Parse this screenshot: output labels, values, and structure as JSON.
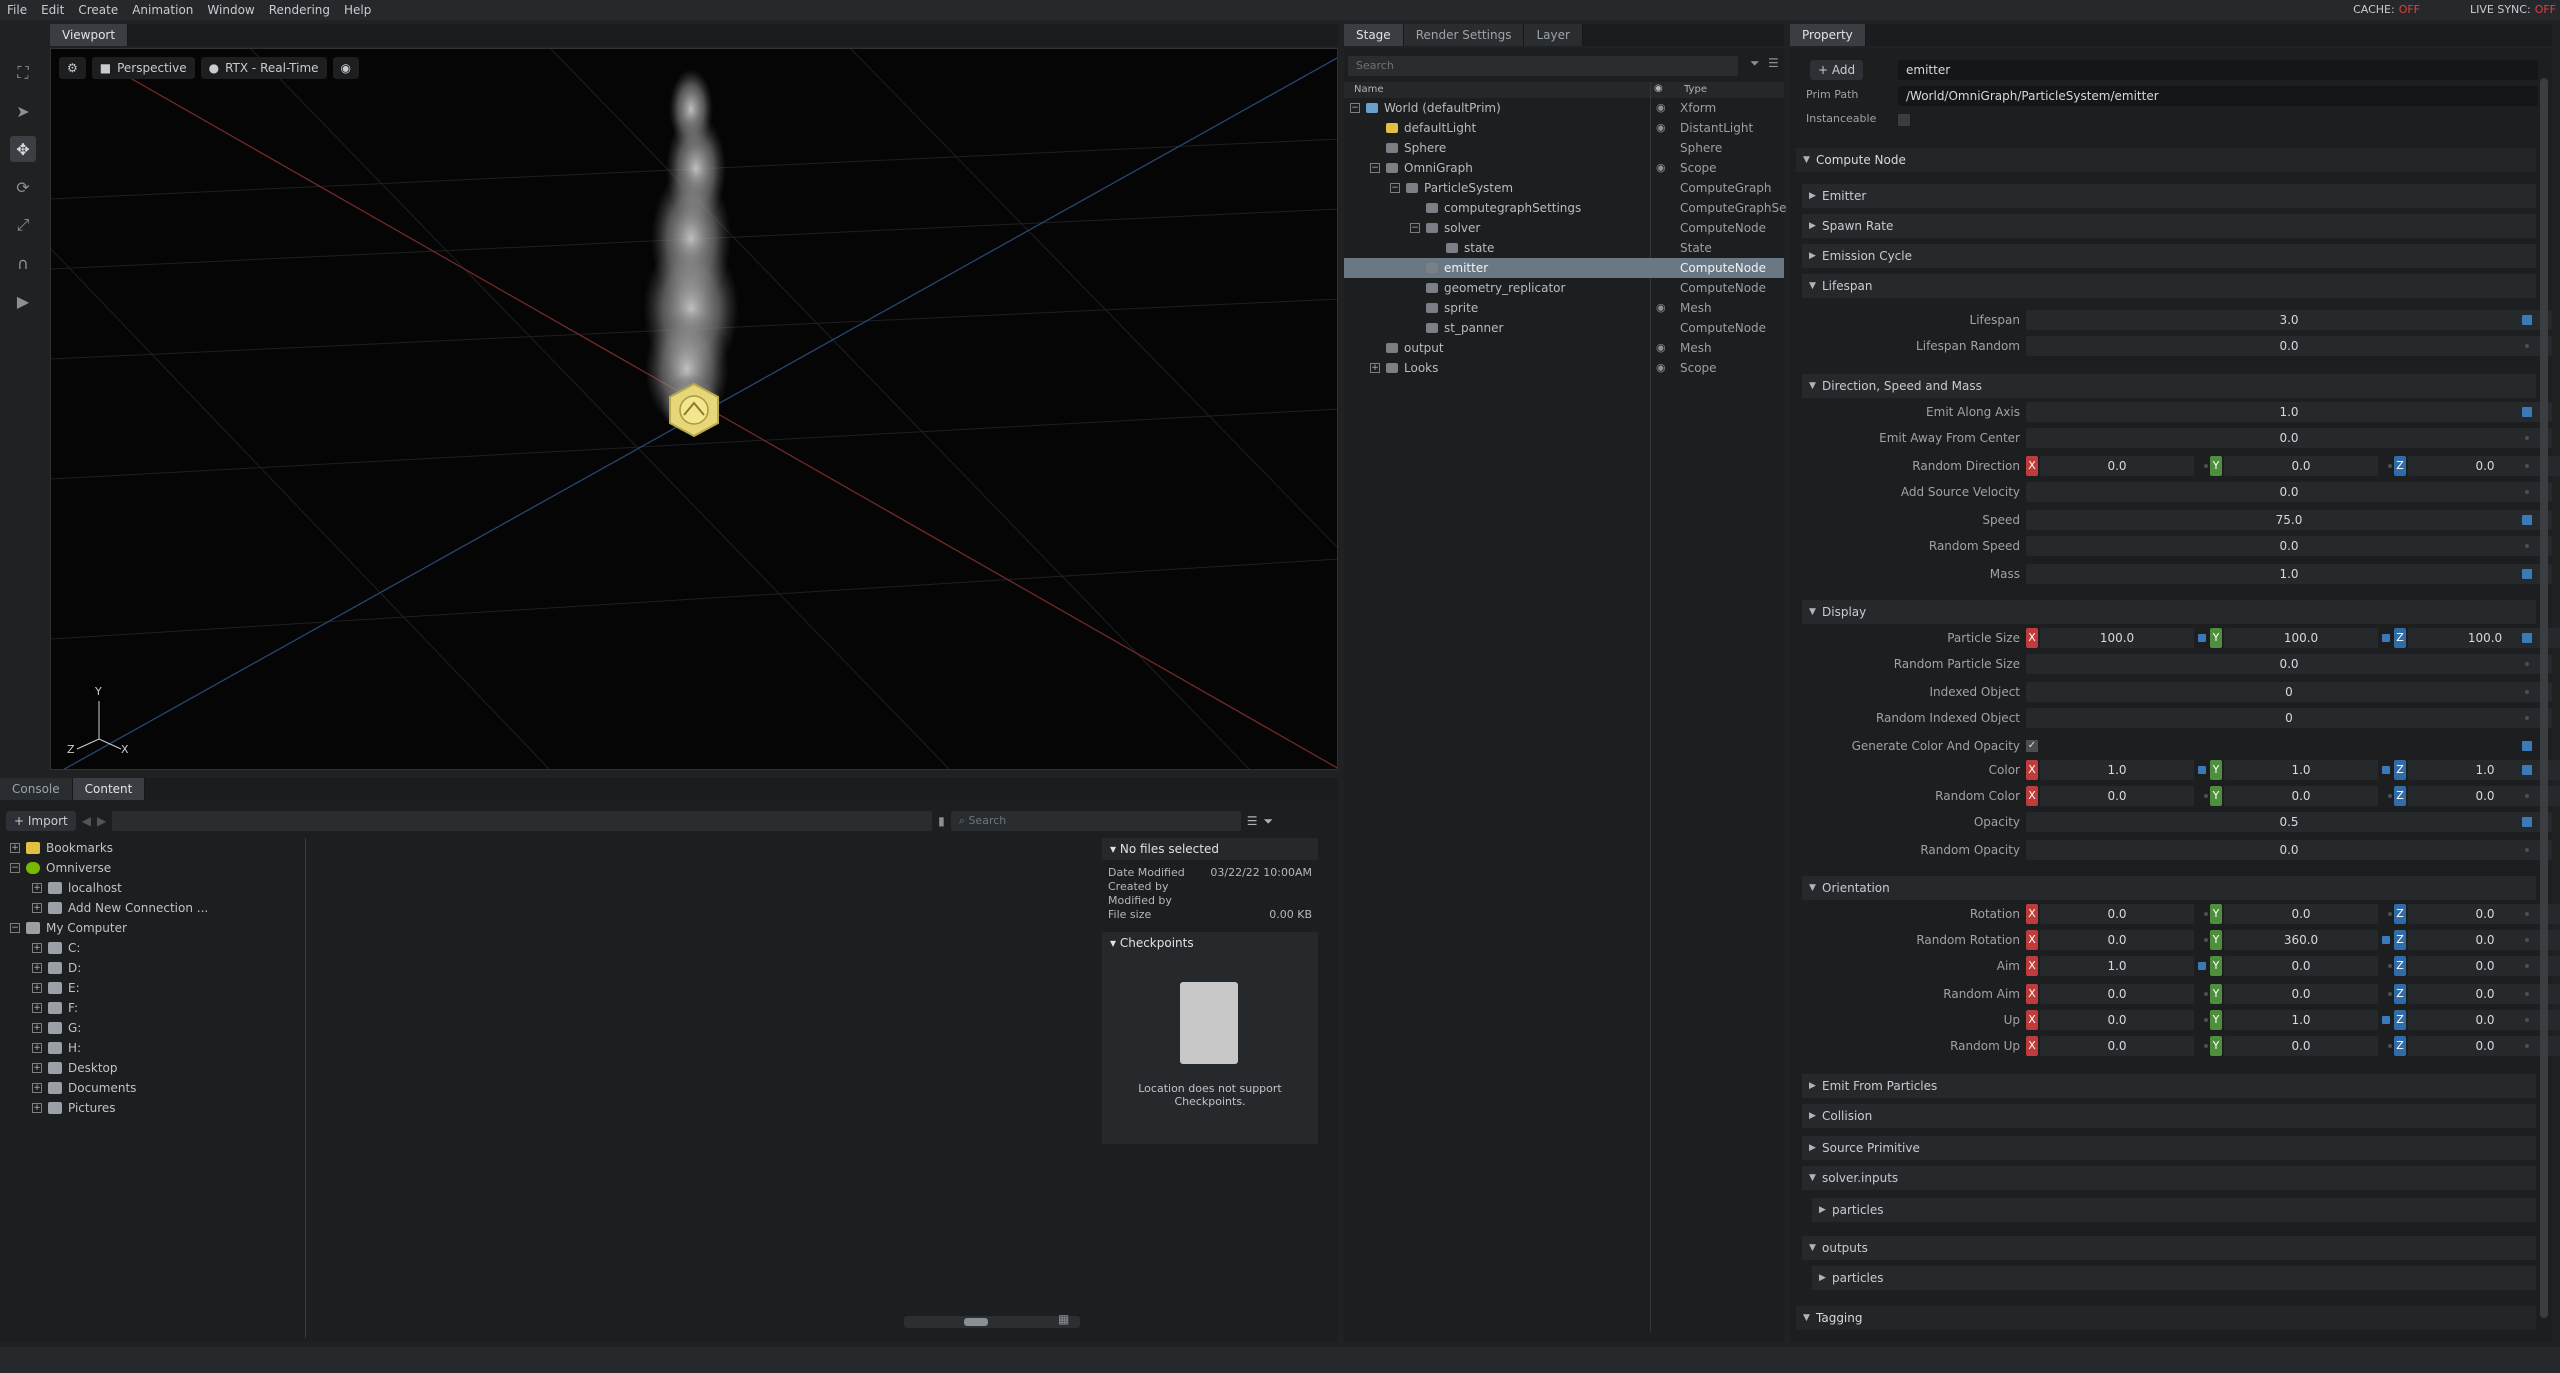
{
  "menubar": {
    "items": [
      "File",
      "Edit",
      "Create",
      "Animation",
      "Window",
      "Rendering",
      "Help"
    ],
    "cache_label": "CACHE:",
    "cache_value": "OFF",
    "livesync_label": "LIVE SYNC:",
    "livesync_value": "OFF"
  },
  "viewport": {
    "tab": "Viewport",
    "camera": "Perspective",
    "renderer": "RTX - Real-Time",
    "axis_y": "Y",
    "axis_z": "Z",
    "axis_x": "X"
  },
  "bottom": {
    "tabs": [
      "Console",
      "Content"
    ],
    "import_label": "Import",
    "search_placeholder": "Search",
    "tree": [
      {
        "label": "Bookmarks",
        "indent": 0,
        "exp": "+",
        "icon": "bookmark-icon"
      },
      {
        "label": "Omniverse",
        "indent": 0,
        "exp": "−",
        "icon": "omniverse-icon"
      },
      {
        "label": "localhost",
        "indent": 1,
        "exp": "+",
        "icon": "server-icon"
      },
      {
        "label": "Add New Connection ...",
        "indent": 1,
        "exp": "+",
        "icon": "add-connection-icon"
      },
      {
        "label": "My Computer",
        "indent": 0,
        "exp": "−",
        "icon": "computer-icon"
      },
      {
        "label": "C:",
        "indent": 1,
        "exp": "+",
        "icon": "drive-icon"
      },
      {
        "label": "D:",
        "indent": 1,
        "exp": "+",
        "icon": "drive-icon"
      },
      {
        "label": "E:",
        "indent": 1,
        "exp": "+",
        "icon": "drive-icon"
      },
      {
        "label": "F:",
        "indent": 1,
        "exp": "+",
        "icon": "drive-icon"
      },
      {
        "label": "G:",
        "indent": 1,
        "exp": "+",
        "icon": "drive-icon"
      },
      {
        "label": "H:",
        "indent": 1,
        "exp": "+",
        "icon": "drive-icon"
      },
      {
        "label": "Desktop",
        "indent": 1,
        "exp": "+",
        "icon": "folder-icon"
      },
      {
        "label": "Documents",
        "indent": 1,
        "exp": "+",
        "icon": "folder-icon"
      },
      {
        "label": "Pictures",
        "indent": 1,
        "exp": "+",
        "icon": "folder-icon"
      }
    ],
    "info": {
      "header": "No files selected",
      "date_modified_label": "Date Modified",
      "date_modified_value": "03/22/22 10:00AM",
      "created_by_label": "Created by",
      "modified_by_label": "Modified by",
      "file_size_label": "File size",
      "file_size_value": "0.00 KB",
      "checkpoints_header": "Checkpoints",
      "checkpoints_msg": "Location does not support Checkpoints."
    }
  },
  "stage": {
    "tabs": [
      "Stage",
      "Render Settings",
      "Layer"
    ],
    "search_placeholder": "Search",
    "col_name": "Name",
    "col_type": "Type",
    "rows": [
      {
        "name": "World (defaultPrim)",
        "type": "Xform",
        "indent": 0,
        "exp": "−",
        "eye": true
      },
      {
        "name": "defaultLight",
        "type": "DistantLight",
        "indent": 1,
        "exp": "",
        "eye": true
      },
      {
        "name": "Sphere",
        "type": "Sphere",
        "indent": 1,
        "exp": "",
        "eye": false
      },
      {
        "name": "OmniGraph",
        "type": "Scope",
        "indent": 1,
        "exp": "−",
        "eye": true
      },
      {
        "name": "ParticleSystem",
        "type": "ComputeGraph",
        "indent": 2,
        "exp": "−",
        "eye": false
      },
      {
        "name": "computegraphSettings",
        "type": "ComputeGraphSe",
        "indent": 3,
        "exp": "",
        "eye": false
      },
      {
        "name": "solver",
        "type": "ComputeNode",
        "indent": 3,
        "exp": "−",
        "eye": false
      },
      {
        "name": "state",
        "type": "State",
        "indent": 4,
        "exp": "",
        "eye": false
      },
      {
        "name": "emitter",
        "type": "ComputeNode",
        "indent": 3,
        "exp": "",
        "eye": false,
        "selected": true
      },
      {
        "name": "geometry_replicator",
        "type": "ComputeNode",
        "indent": 3,
        "exp": "",
        "eye": false
      },
      {
        "name": "sprite",
        "type": "Mesh",
        "indent": 3,
        "exp": "",
        "eye": true
      },
      {
        "name": "st_panner",
        "type": "ComputeNode",
        "indent": 3,
        "exp": "",
        "eye": false
      },
      {
        "name": "output",
        "type": "Mesh",
        "indent": 1,
        "exp": "",
        "eye": true
      },
      {
        "name": "Looks",
        "type": "Scope",
        "indent": 1,
        "exp": "+",
        "eye": true
      }
    ]
  },
  "property": {
    "tab": "Property",
    "add_label": "Add",
    "name_value": "emitter",
    "prim_path_label": "Prim Path",
    "prim_path_value": "/World/OmniGraph/ParticleSystem/emitter",
    "instanceable_label": "Instanceable",
    "compute_node": "Compute Node",
    "emitter": "Emitter",
    "spawn_rate": "Spawn Rate",
    "emission_cycle": "Emission Cycle",
    "lifespan_sect": "Lifespan",
    "lifespan_label": "Lifespan",
    "lifespan_value": "3.0",
    "lifespan_random_label": "Lifespan Random",
    "lifespan_random_value": "0.0",
    "dsm_sect": "Direction, Speed and Mass",
    "emit_along_axis_label": "Emit Along Axis",
    "emit_along_axis_value": "1.0",
    "emit_away_label": "Emit Away From Center",
    "emit_away_value": "0.0",
    "random_direction_label": "Random Direction",
    "random_direction": [
      "0.0",
      "0.0",
      "0.0"
    ],
    "add_source_velocity_label": "Add Source Velocity",
    "add_source_velocity_value": "0.0",
    "speed_label": "Speed",
    "speed_value": "75.0",
    "random_speed_label": "Random Speed",
    "random_speed_value": "0.0",
    "mass_label": "Mass",
    "mass_value": "1.0",
    "display_sect": "Display",
    "particle_size_label": "Particle Size",
    "particle_size": [
      "100.0",
      "100.0",
      "100.0"
    ],
    "random_particle_size_label": "Random Particle Size",
    "random_particle_size_value": "0.0",
    "indexed_object_label": "Indexed Object",
    "indexed_object_value": "0",
    "random_indexed_object_label": "Random Indexed Object",
    "random_indexed_object_value": "0",
    "gen_color_label": "Generate Color And Opacity",
    "color_label": "Color",
    "color": [
      "1.0",
      "1.0",
      "1.0"
    ],
    "random_color_label": "Random Color",
    "random_color": [
      "0.0",
      "0.0",
      "0.0"
    ],
    "opacity_label": "Opacity",
    "opacity_value": "0.5",
    "random_opacity_label": "Random Opacity",
    "random_opacity_value": "0.0",
    "orientation_sect": "Orientation",
    "rotation_label": "Rotation",
    "rotation": [
      "0.0",
      "0.0",
      "0.0"
    ],
    "random_rotation_label": "Random Rotation",
    "random_rotation": [
      "0.0",
      "360.0",
      "0.0"
    ],
    "aim_label": "Aim",
    "aim": [
      "1.0",
      "0.0",
      "0.0"
    ],
    "random_aim_label": "Random Aim",
    "random_aim": [
      "0.0",
      "0.0",
      "0.0"
    ],
    "up_label": "Up",
    "up": [
      "0.0",
      "1.0",
      "0.0"
    ],
    "random_up_label": "Random Up",
    "random_up": [
      "0.0",
      "0.0",
      "0.0"
    ],
    "emit_from_particles": "Emit From Particles",
    "collision": "Collision",
    "source_primitive": "Source Primitive",
    "solver_inputs": "solver.inputs",
    "particles_1": "particles",
    "outputs": "outputs",
    "particles_2": "particles",
    "tagging": "Tagging"
  }
}
